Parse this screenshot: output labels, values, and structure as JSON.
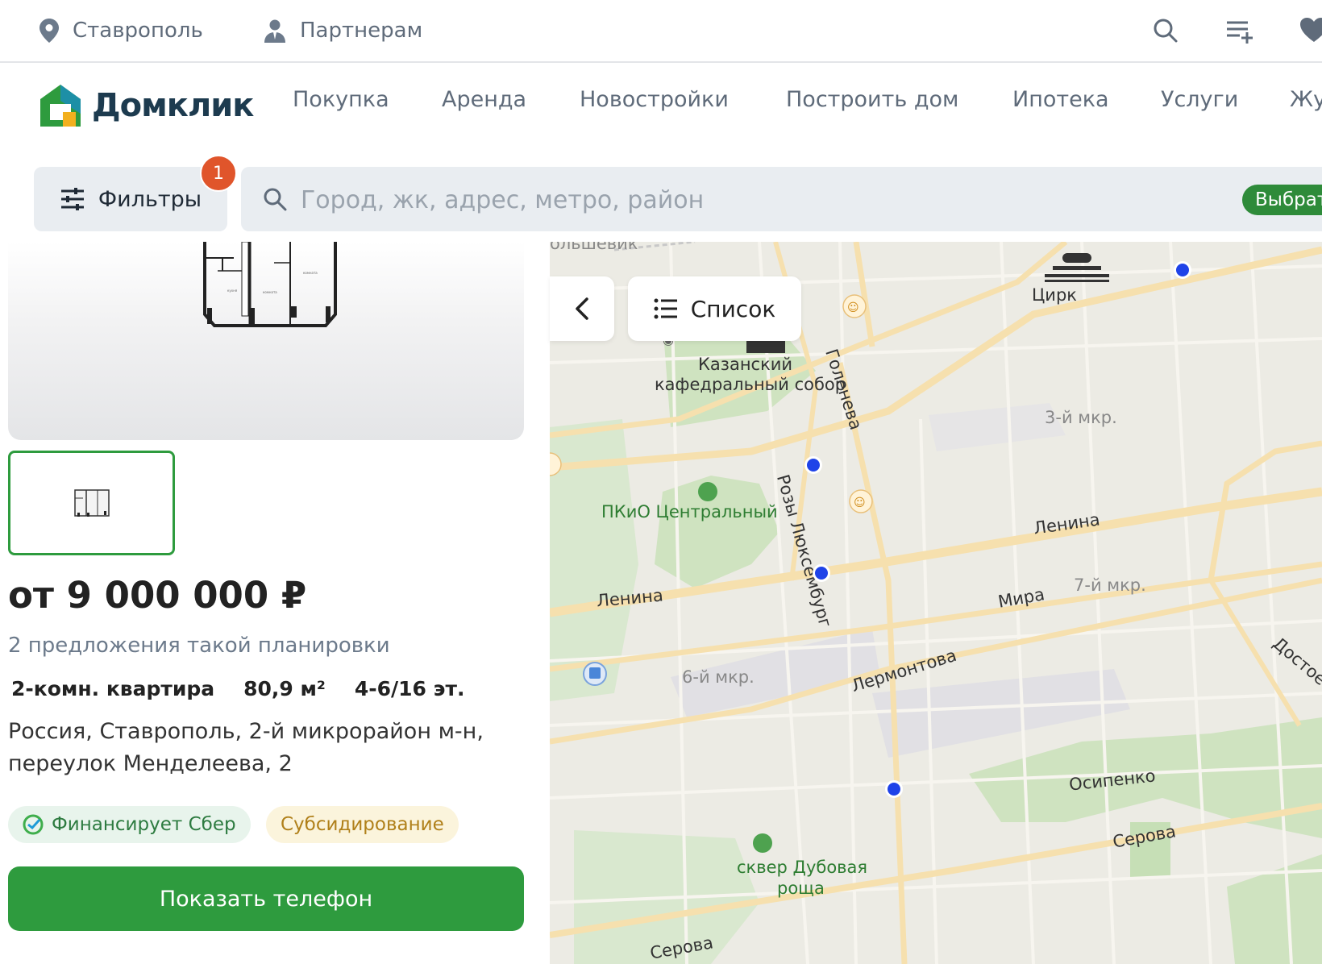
{
  "topbar": {
    "city": "Ставрополь",
    "partners": "Партнерам",
    "icons": [
      "location-pin-icon",
      "person-icon",
      "search-icon",
      "add-list-icon",
      "heart-icon"
    ]
  },
  "nav": {
    "logo_text": "Домклик",
    "items": [
      "Покупка",
      "Аренда",
      "Новостройки",
      "Построить дом",
      "Ипотека",
      "Услуги",
      "Жу"
    ]
  },
  "search": {
    "filters_label": "Фильтры",
    "filters_count": "1",
    "placeholder": "Город, жк, адрес, метро, район",
    "select_button": "Выбрат"
  },
  "card": {
    "price": "от 9 000 000 ₽",
    "offers": "2 предложения такой планировки",
    "specs": [
      "2-комн. квартира",
      "80,9 м²",
      "4-6/16 эт."
    ],
    "address": "Россия, Ставрополь, 2-й микрорайон м-н, переулок Менделеева, 2",
    "tags": [
      "Финансирует Сбер",
      "Субсидирование"
    ],
    "phone_button": "Показать телефон"
  },
  "map": {
    "list_button": "Список",
    "labels": {
      "bolshevik": "ольшевик",
      "cirk": "Цирк",
      "kazan": "Казанский",
      "kazan2": "кафедральный собор",
      "goleneva": "Голенева",
      "mkr3": "3-й мкр.",
      "pkio": "ПКиО Центральный",
      "rozy": "Розы Люксембург",
      "lenina_right": "Ленина",
      "lenina_left": "Ленина",
      "mkr7": "7-й мкр.",
      "mira": "Мира",
      "dost": "Достое",
      "mkr6": "6-й мкр.",
      "lermontova": "Лермонтова",
      "osipenko": "Осипенко",
      "serova_right": "Серова",
      "serova_left": "Серова",
      "skver": "сквер Дубовая",
      "skver2": "роща"
    }
  },
  "colors": {
    "accent_green": "#2e9b3e",
    "badge_orange": "#e0552b",
    "marker_blue": "#1f43e8"
  }
}
